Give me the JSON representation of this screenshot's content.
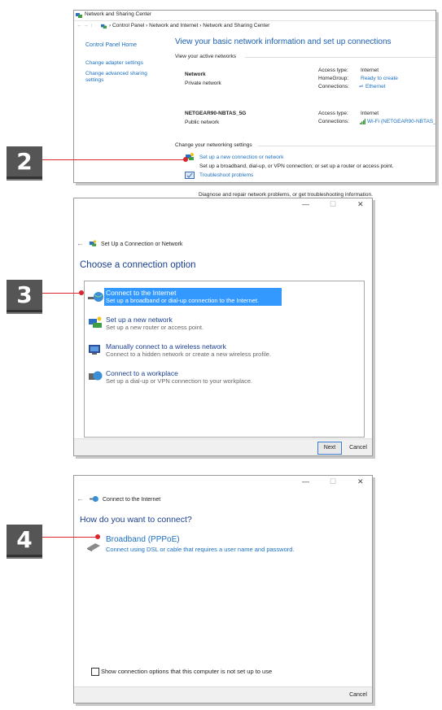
{
  "steps": {
    "s2": "2",
    "s3": "3",
    "s4": "4"
  },
  "colors": {
    "pointer": "#d9262c",
    "link": "#1a6fc2",
    "selection": "#3399ff"
  },
  "w1": {
    "title": "Network and Sharing Center",
    "breadcrumb": "›  Control Panel  ›  Network and Internet  ›  Network and Sharing Center",
    "sidebar": [
      "Control Panel Home",
      "Change adapter settings",
      "Change advanced sharing settings"
    ],
    "heading": "View your basic network information and set up connections",
    "active_label": "View your active networks",
    "net1": {
      "name": "Network",
      "type": "Private network",
      "k1": "Access type:",
      "v1": "Internet",
      "k2": "HomeGroup:",
      "v2": "Ready to create",
      "k3": "Connections:",
      "v3": "Ethernet"
    },
    "net2": {
      "name": "NETGEAR90-NBTAS_5G",
      "type": "Public network",
      "k1": "Access type:",
      "v1": "Internet",
      "k2": "Connections:",
      "v2": "Wi-Fi (NETGEAR90-NBTAS_5G)"
    },
    "change_label": "Change your networking settings",
    "item1_title": "Set up a new connection or network",
    "item1_desc": "Set up a broadband, dial-up, or VPN connection; or set up a router or access point.",
    "item2_title": "Troubleshoot problems",
    "item2_desc": "Diagnose and repair network problems, or get troubleshooting information."
  },
  "w2": {
    "ctl": {
      "min": "—",
      "max": "☐",
      "close": "✕"
    },
    "back": "←",
    "title": "Set Up a Connection or Network",
    "heading": "Choose a connection option",
    "options": [
      {
        "title": "Connect to the Internet",
        "desc": "Set up a broadband or dial-up connection to the Internet."
      },
      {
        "title": "Set up a new network",
        "desc": "Set up a new router or access point."
      },
      {
        "title": "Manually connect to a wireless network",
        "desc": "Connect to a hidden network or create a new wireless profile."
      },
      {
        "title": "Connect to a workplace",
        "desc": "Set up a dial-up or VPN connection to your workplace."
      }
    ],
    "next": "Next",
    "cancel": "Cancel"
  },
  "w3": {
    "ctl": {
      "min": "—",
      "max": "☐",
      "close": "✕"
    },
    "back": "←",
    "title": "Connect to the Internet",
    "heading": "How do you want to connect?",
    "option_title": "Broadband (PPPoE)",
    "option_desc": "Connect using DSL or cable that requires a user name and password.",
    "checkbox_label": "Show connection options that this computer is not set up to use",
    "cancel": "Cancel"
  }
}
